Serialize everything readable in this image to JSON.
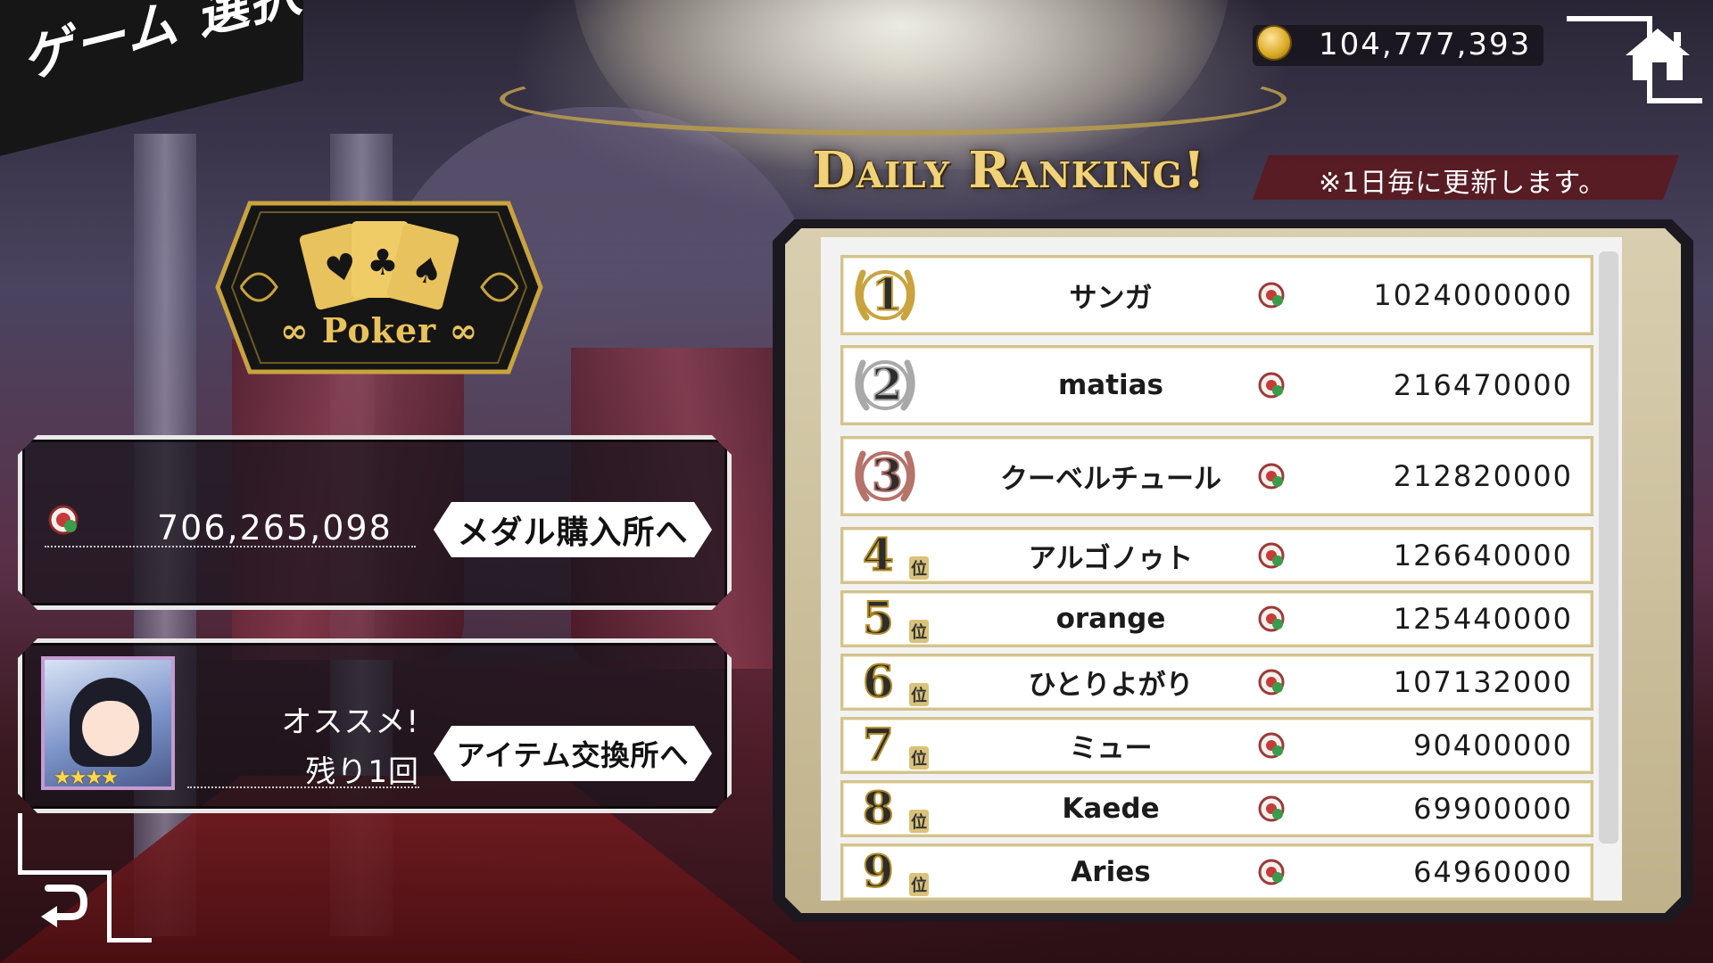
{
  "header": {
    "screen_title": "ゲーム 選択",
    "coins": "104,777,393"
  },
  "game": {
    "name": "Poker"
  },
  "medal_panel": {
    "medals": "706,265,098",
    "button_label": "メダル購入所へ"
  },
  "item_panel": {
    "recommend_label": "オススメ!",
    "remaining_label": "残り1回",
    "button_label": "アイテム交換所へ",
    "card_stars": "★★★★"
  },
  "ranking": {
    "title": "Daily Ranking!",
    "note": "※1日毎に更新します。",
    "rank_suffix": "位",
    "rows": [
      {
        "rank": "1",
        "name": "サンガ",
        "score": "1024000000"
      },
      {
        "rank": "2",
        "name": "matias",
        "score": "216470000"
      },
      {
        "rank": "3",
        "name": "クーベルチュール",
        "score": "212820000"
      },
      {
        "rank": "4",
        "name": "アルゴノゥト",
        "score": "126640000"
      },
      {
        "rank": "5",
        "name": "orange",
        "score": "125440000"
      },
      {
        "rank": "6",
        "name": "ひとりよがり",
        "score": "107132000"
      },
      {
        "rank": "7",
        "name": "ミュー",
        "score": "90400000"
      },
      {
        "rank": "8",
        "name": "Kaede",
        "score": "69900000"
      },
      {
        "rank": "9",
        "name": "Aries",
        "score": "64960000"
      }
    ]
  },
  "icons": {
    "home": "home-icon",
    "back": "back-arrow-icon",
    "coin": "gold-coin-icon",
    "chip": "poker-chip-icon"
  },
  "colors": {
    "gold": "#e8c25c",
    "medal_gold": "#c9a33e",
    "medal_silver": "#a9a9a9",
    "medal_bronze": "#b5736a"
  }
}
